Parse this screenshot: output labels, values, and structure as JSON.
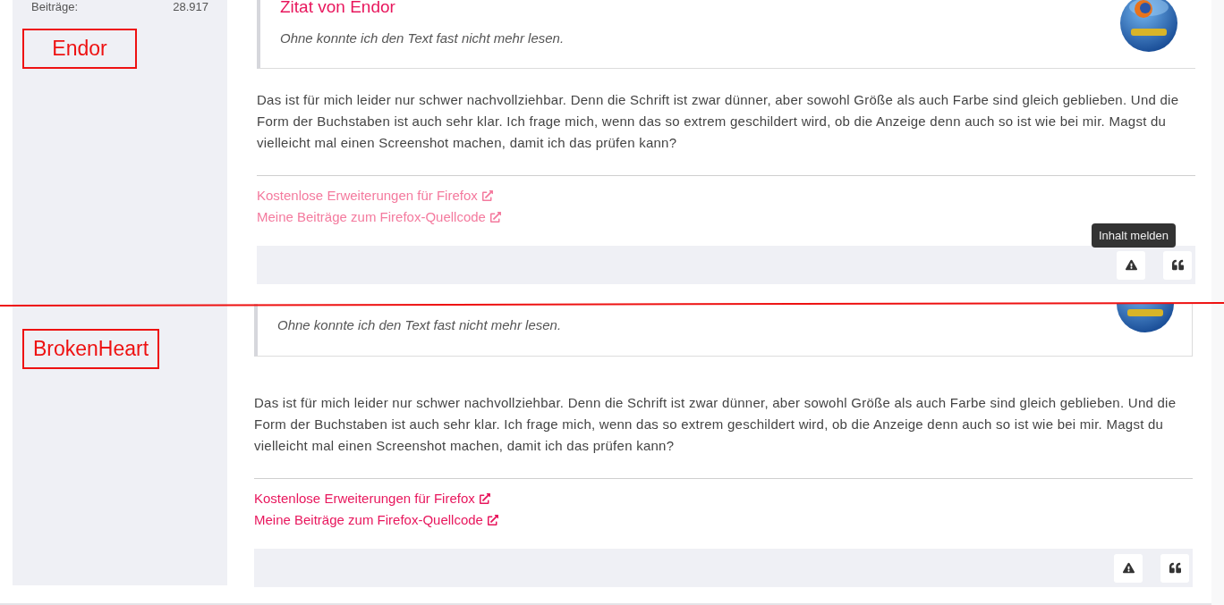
{
  "posts": [
    {
      "sidebar": {
        "stat_label": "Beiträge:",
        "stat_value": "28.917"
      },
      "annotation": "Endor",
      "faded": true,
      "quote": {
        "title": "Zitat von Endor",
        "text": "Ohne konnte ich den Text fast nicht mehr lesen."
      },
      "body": "Das ist für mich leider nur schwer nachvollziehbar. Denn die Schrift ist zwar dünner, aber sowohl Größe als auch Farbe sind gleich geblieben. Und die Form der Buchstaben ist auch sehr klar. Ich frage mich, wenn das so extrem geschildert wird, ob die Anzeige denn auch so ist wie bei mir. Magst du vielleicht mal einen Screenshot machen, damit ich das prüfen kann?",
      "links": [
        "Kostenlose Erweiterungen für Firefox",
        "Meine Beiträge zum Firefox-Quellcode"
      ],
      "tooltip": "Inhalt melden"
    },
    {
      "annotation": "BrokenHeart",
      "faded": false,
      "quote": {
        "text": "Ohne konnte ich den Text fast nicht mehr lesen."
      },
      "body": "Das ist für mich leider nur schwer nachvollziehbar. Denn die Schrift ist zwar dünner, aber sowohl Größe als auch Farbe sind gleich geblieben. Und die Form der Buchstaben ist auch sehr klar. Ich frage mich, wenn das so extrem geschildert wird, ob die Anzeige denn auch so ist wie bei mir. Magst du vielleicht mal einen Screenshot machen, damit ich das prüfen kann?",
      "links": [
        "Kostenlose Erweiterungen für Firefox",
        "Meine Beiträge zum Firefox-Quellcode"
      ]
    }
  ]
}
